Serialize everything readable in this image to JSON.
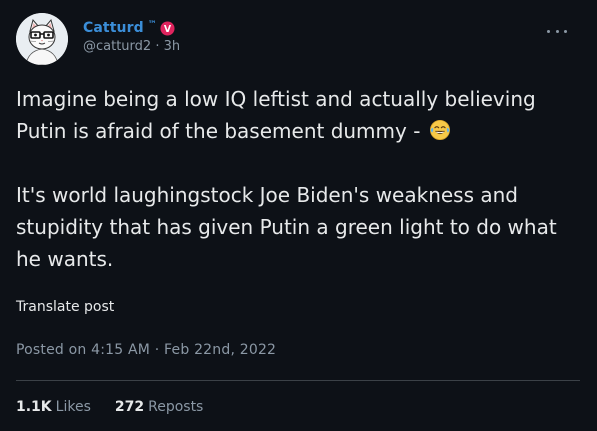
{
  "author": {
    "display_name": "Catturd",
    "tm": "™",
    "handle": "@catturd2",
    "separator": "·",
    "time_ago": "3h",
    "name_color": "#3b8ed8",
    "badge_color": "#e0245e",
    "avatar_icon": "cat-avatar-icon"
  },
  "post": {
    "paragraph1": "Imagine being a low IQ leftist and actually believing Putin is afraid of the basement dummy - ",
    "emoji": "face-with-tears-of-joy",
    "paragraph2": "It's world laughingstock Joe Biden's weakness and stupidity that has given Putin a green light to do what he wants."
  },
  "translate_label": "Translate post",
  "posted_line": "Posted on 4:15 AM · Feb 22nd, 2022",
  "stats": {
    "likes_count": "1.1K",
    "likes_label": "Likes",
    "reposts_count": "272",
    "reposts_label": "Reposts"
  },
  "more_icon": "ellipsis-icon"
}
